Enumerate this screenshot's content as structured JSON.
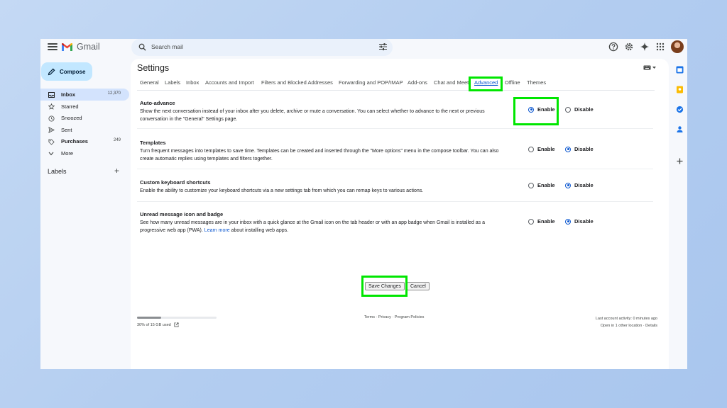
{
  "app": {
    "name": "Gmail",
    "search_placeholder": "Search mail"
  },
  "sidebar": {
    "compose_label": "Compose",
    "items": [
      {
        "label": "Inbox",
        "count": "12,370",
        "icon": "inbox-icon",
        "bold": true
      },
      {
        "label": "Starred",
        "count": "",
        "icon": "star-icon",
        "bold": false
      },
      {
        "label": "Snoozed",
        "count": "",
        "icon": "clock-icon",
        "bold": false
      },
      {
        "label": "Sent",
        "count": "",
        "icon": "send-icon",
        "bold": false
      },
      {
        "label": "Purchases",
        "count": "249",
        "icon": "tag-icon",
        "bold": true
      },
      {
        "label": "More",
        "count": "",
        "icon": "chevron-down-icon",
        "bold": false
      }
    ],
    "labels_heading": "Labels",
    "labels_add": "+"
  },
  "settings": {
    "title": "Settings",
    "tabs": [
      {
        "label": "General"
      },
      {
        "label": "Labels"
      },
      {
        "label": "Inbox"
      },
      {
        "label": "Accounts and Import"
      },
      {
        "label": "Filters and Blocked Addresses"
      },
      {
        "label": "Forwarding and POP/IMAP"
      },
      {
        "label": "Add-ons"
      },
      {
        "label": "Chat and Meet"
      },
      {
        "label": "Advanced",
        "active": true
      },
      {
        "label": "Offline"
      },
      {
        "label": "Themes"
      }
    ],
    "sections": [
      {
        "title": "Auto-advance",
        "description": "Show the next conversation instead of your inbox after you delete, archive or mute a conversation. You can select whether to advance to the next or previous conversation in the \"General\" Settings page.",
        "enable_label": "Enable",
        "disable_label": "Disable",
        "selected": "enable"
      },
      {
        "title": "Templates",
        "description": "Turn frequent messages into templates to save time. Templates can be created and inserted through the \"More options\" menu in the compose toolbar. You can also create automatic replies using templates and filters together.",
        "enable_label": "Enable",
        "disable_label": "Disable",
        "selected": "disable"
      },
      {
        "title": "Custom keyboard shortcuts",
        "description": "Enable the ability to customize your keyboard shortcuts via a new settings tab from which you can remap keys to various actions.",
        "enable_label": "Enable",
        "disable_label": "Disable",
        "selected": "disable"
      },
      {
        "title": "Unread message icon and badge",
        "description": "See how many unread messages are in your inbox with a quick glance at the Gmail icon on the tab header or with an app badge when Gmail is installed as a progressive web app (PWA).",
        "link_text": "Learn more",
        "description_suffix": "about installing web apps.",
        "enable_label": "Enable",
        "disable_label": "Disable",
        "selected": "disable"
      }
    ],
    "save_label": "Save Changes",
    "cancel_label": "Cancel"
  },
  "footer": {
    "storage_text": "30% of 15 GB used",
    "storage_fraction": 0.3,
    "links": "Terms · Privacy · Program Policies",
    "last_activity": "Last account activity: 0 minutes ago",
    "open_location": "Open in 1 other location · Details"
  },
  "colors": {
    "accent": "#0b57d0",
    "compose_bg": "#c2e7ff",
    "highlight": "#00e600"
  }
}
